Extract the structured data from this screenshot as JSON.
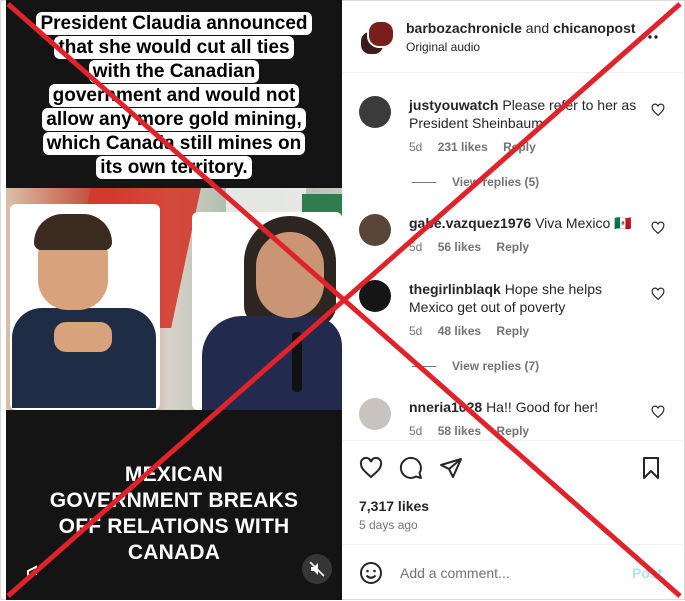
{
  "video": {
    "caption_lines": [
      "President Claudia announced",
      "that she would cut all ties",
      "with the Canadian",
      "government and would not",
      "allow any more gold mining,",
      "which Canada still mines on",
      "its own territory."
    ],
    "headline_lines": [
      "MEXICAN",
      "GOVERNMENT BREAKS",
      "OFF RELATIONS WITH",
      "CANADA"
    ],
    "mute_icon": "speaker-muted-icon"
  },
  "header": {
    "user1": "barbozachronicle",
    "joiner": " and ",
    "user2": "chicanopost",
    "audio": "Original audio",
    "more_icon": "more-horizontal-icon"
  },
  "comments": [
    {
      "user": "justyouwatch",
      "text": "Please refer to her as President Sheinbaum",
      "age": "5d",
      "likes": "231 likes",
      "reply": "Reply",
      "avatar_color": "#3b3b3b"
    },
    {
      "user": "gabe.vazquez1976",
      "text": "Viva Mexico 🇲🇽",
      "age": "5d",
      "likes": "56 likes",
      "reply": "Reply",
      "avatar_color": "#5a4638"
    },
    {
      "user": "thegirlinblaqk",
      "text": "Hope she helps Mexico get out of poverty",
      "age": "5d",
      "likes": "48 likes",
      "reply": "Reply",
      "avatar_color": "#151515"
    },
    {
      "user": "nneria1028",
      "text": "Ha!! Good for her!",
      "age": "5d",
      "likes": "58 likes",
      "reply": "Reply",
      "avatar_color": "#c9c3bf"
    }
  ],
  "view_replies": [
    "View replies (5)",
    "View replies (7)"
  ],
  "actions": {
    "likes": "7,317 likes",
    "time_ago": "5 days ago"
  },
  "add_comment": {
    "placeholder": "Add a comment...",
    "post": "Post"
  },
  "colors": {
    "overlay_x": "#e0222a",
    "link_blue_disabled": "#b2dffc"
  }
}
